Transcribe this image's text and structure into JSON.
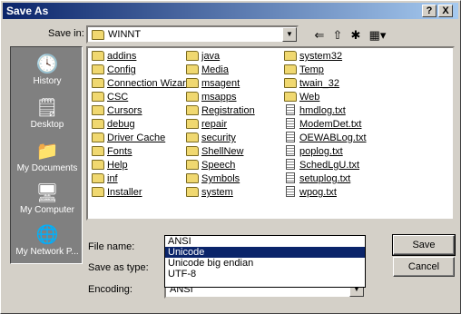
{
  "window": {
    "title": "Save As",
    "help_label": "?",
    "close_label": "X"
  },
  "save_in": {
    "label": "Save in:",
    "value": "WINNT"
  },
  "toolbar": {
    "back_icon": "back-arrow-icon",
    "up_icon": "up-folder-icon",
    "new_folder_icon": "new-folder-icon",
    "views_icon": "views-menu-icon"
  },
  "places": [
    {
      "label": "History",
      "icon": "history-icon"
    },
    {
      "label": "Desktop",
      "icon": "desktop-icon"
    },
    {
      "label": "My Documents",
      "icon": "my-documents-icon"
    },
    {
      "label": "My Computer",
      "icon": "my-computer-icon"
    },
    {
      "label": "My Network P...",
      "icon": "my-network-places-icon"
    }
  ],
  "files": {
    "col1": [
      {
        "name": "addins",
        "type": "folder"
      },
      {
        "name": "Config",
        "type": "folder"
      },
      {
        "name": "Connection Wizard",
        "type": "folder"
      },
      {
        "name": "CSC",
        "type": "folder"
      },
      {
        "name": "Cursors",
        "type": "folder"
      },
      {
        "name": "debug",
        "type": "folder"
      },
      {
        "name": "Driver Cache",
        "type": "folder"
      },
      {
        "name": "Fonts",
        "type": "folder"
      },
      {
        "name": "Help",
        "type": "folder"
      },
      {
        "name": "inf",
        "type": "folder"
      },
      {
        "name": "Installer",
        "type": "folder"
      }
    ],
    "col2": [
      {
        "name": "java",
        "type": "folder"
      },
      {
        "name": "Media",
        "type": "folder"
      },
      {
        "name": "msagent",
        "type": "folder"
      },
      {
        "name": "msapps",
        "type": "folder"
      },
      {
        "name": "Registration",
        "type": "folder"
      },
      {
        "name": "repair",
        "type": "folder"
      },
      {
        "name": "security",
        "type": "folder"
      },
      {
        "name": "ShellNew",
        "type": "folder"
      },
      {
        "name": "Speech",
        "type": "folder"
      },
      {
        "name": "Symbols",
        "type": "folder"
      },
      {
        "name": "system",
        "type": "folder"
      }
    ],
    "col3": [
      {
        "name": "system32",
        "type": "folder"
      },
      {
        "name": "Temp",
        "type": "folder"
      },
      {
        "name": "twain_32",
        "type": "folder"
      },
      {
        "name": "Web",
        "type": "folder"
      },
      {
        "name": "hmdlog.txt",
        "type": "text"
      },
      {
        "name": "ModemDet.txt",
        "type": "text"
      },
      {
        "name": "OEWABLog.txt",
        "type": "text"
      },
      {
        "name": "poplog.txt",
        "type": "text"
      },
      {
        "name": "SchedLgU.txt",
        "type": "text"
      },
      {
        "name": "setuplog.txt",
        "type": "text"
      },
      {
        "name": "wpog.txt",
        "type": "text"
      }
    ]
  },
  "file_name": {
    "label": "File name:",
    "value": ""
  },
  "save_as_type": {
    "label": "Save as type:"
  },
  "encoding": {
    "label": "Encoding:",
    "value": "ANSI",
    "options": [
      "ANSI",
      "Unicode",
      "Unicode big endian",
      "UTF-8"
    ],
    "selected": "Unicode"
  },
  "buttons": {
    "save": "Save",
    "cancel": "Cancel"
  },
  "colors": {
    "title_start": "#0a246a",
    "title_end": "#a6caf0",
    "selection": "#0a246a",
    "folder": "#f0d870"
  }
}
